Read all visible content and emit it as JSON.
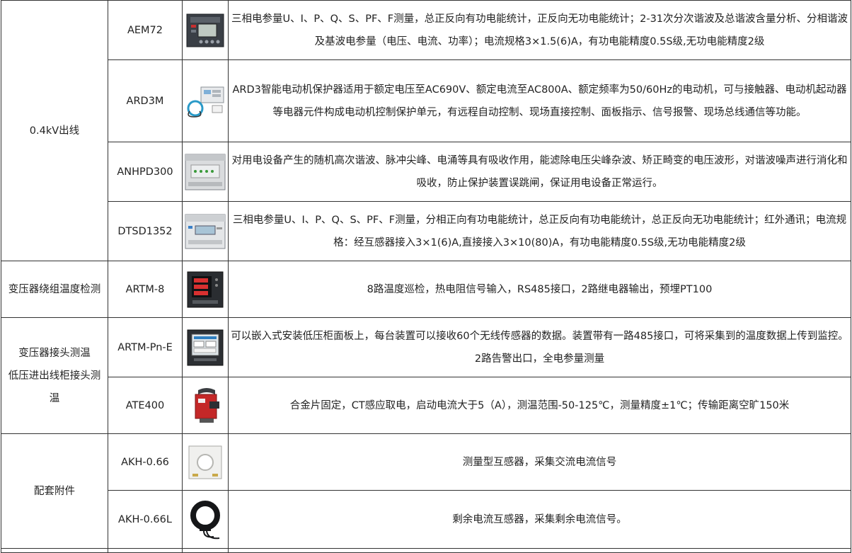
{
  "rows": [
    {
      "model": "AEM72",
      "icon": "multifunction-meter-icon",
      "desc": "三相电参量U、I、P、Q、S、PF、F测量，总正反向有功电能统计，正反向无功电能统计；2-31次分次谐波及总谐波含量分析、分相谐波及基波电参量（电压、电流、功率）；电流规格3×1.5(6)A，有功电能精度0.5S级,无功电能精度2级"
    },
    {
      "model": "ARD3M",
      "icon": "motor-protector-icon",
      "desc": "ARD3智能电动机保护器适用于额定电压至AC690V、额定电流至AC800A、额定频率为50/60Hz的电动机，可与接触器、电动机起动器等电器元件构成电动机控制保护单元，有远程自动控制、现场直接控制、面板指示、信号报警、现场总线通信等功能。"
    },
    {
      "model": "ANHPD300",
      "icon": "harmonic-protector-icon",
      "desc": "对用电设备产生的随机高次谐波、脉冲尖峰、电涌等具有吸收作用，能滤除电压尖峰杂波、矫正畸变的电压波形，对谐波噪声进行消化和吸收，防止保护装置误跳闸，保证用电设备正常运行。"
    },
    {
      "model": "DTSD1352",
      "icon": "din-rail-meter-icon",
      "desc": "三相电参量U、I、P、Q、S、PF、F测量，分相正向有功电能统计，总正反向有功电能统计，总正反向无功电能统计；红外通讯；电流规格：经互感器接入3×1(6)A,直接接入3×10(80)A，有功电能精度0.5S级,无功电能精度2级"
    },
    {
      "model": "ARTM-8",
      "icon": "temperature-monitor-icon",
      "desc": "8路温度巡检，热电阻信号输入，RS485接口，2路继电器输出，预埋PT100"
    },
    {
      "model": "ARTM-Pn-E",
      "icon": "wireless-temp-display-icon",
      "desc": "可以嵌入式安装低压柜面板上，每台装置可以接收60个无线传感器的数据。装置带有一路485接口，可将采集到的温度数据上传到监控。2路告警出口，全电参量测量"
    },
    {
      "model": "ATE400",
      "icon": "wireless-temp-sensor-icon",
      "desc": "合金片固定，CT感应取电，启动电流大于5（A），测温范围-50-125℃，测量精度±1℃；传输距离空旷150米"
    },
    {
      "model": "AKH-0.66",
      "icon": "current-transformer-icon",
      "desc": "测量型互感器，采集交流电流信号"
    },
    {
      "model": "AKH-0.66L",
      "icon": "residual-current-transformer-icon",
      "desc": "剩余电流互感器，采集剩余电流信号。"
    }
  ],
  "categories": {
    "outgoing": "0.4kV出线",
    "winding": "变压器绕组温度检测",
    "joint_line1": "变压器接头测温",
    "joint_line2": "低压进出线柜接头测",
    "joint_line3": "温",
    "accessories": "配套附件"
  }
}
